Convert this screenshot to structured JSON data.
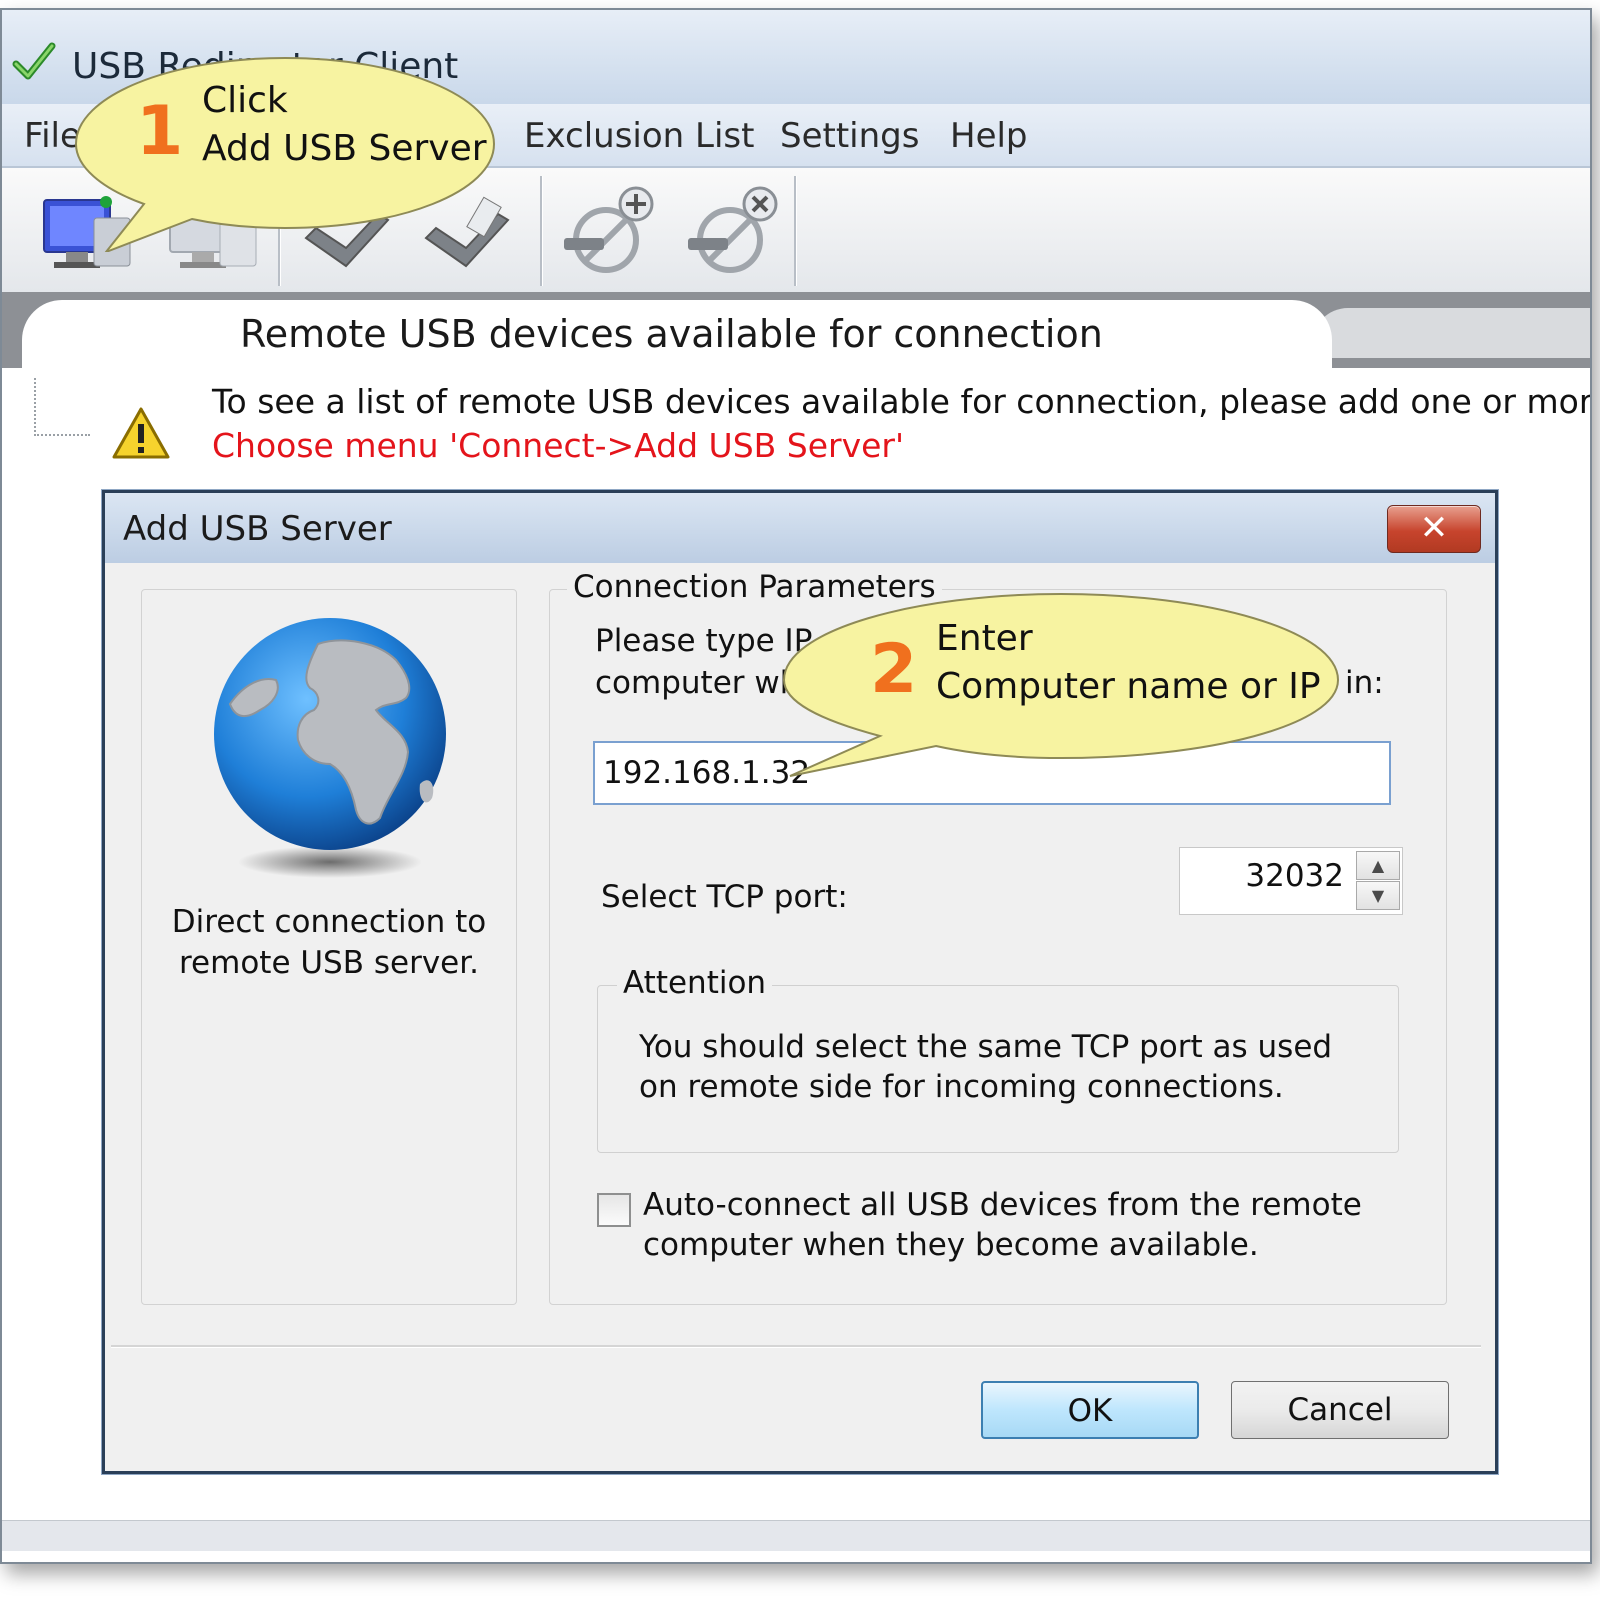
{
  "window": {
    "title": "USB Redirector Client"
  },
  "menu": [
    "File",
    "Exclusion List",
    "Settings",
    "Help"
  ],
  "toolbar": {
    "buttons": [
      "add-usb-server",
      "remove-usb-server",
      "connect-device",
      "disconnect-device",
      "add-exclusion",
      "remove-exclusion"
    ]
  },
  "tab": {
    "title": "Remote USB devices available for connection"
  },
  "info": {
    "line1": "To see a list of remote USB devices available for connection, please add one or more",
    "line2": "Choose menu 'Connect->Add USB Server'"
  },
  "callout1": {
    "number": "1",
    "line1": "Click",
    "line2": "Add USB Server"
  },
  "callout2": {
    "number": "2",
    "line1": "Enter",
    "line2": "Computer name or IP"
  },
  "dialog": {
    "title": "Add USB Server",
    "close_label": "✕",
    "left_caption": "Direct connection to remote USB server.",
    "group_title": "Connection Parameters",
    "prompt_line1": "Please type IP",
    "prompt_line2": "computer whe",
    "prompt_tail": "in:",
    "ip_value": "192.168.1.32",
    "port_label": "Select TCP port:",
    "port_value": "32032",
    "attention_title": "Attention",
    "attention_text": "You should select the same TCP port as used on remote side for incoming connections.",
    "autoconnect_label": "Auto-connect all USB devices from the remote computer when they become available.",
    "autoconnect_checked": false,
    "ok_label": "OK",
    "cancel_label": "Cancel"
  },
  "colors": {
    "callout_fill": "#f7f3a1",
    "callout_number": "#f0701e",
    "warning_text": "#e4141b",
    "globe_blue": "#1f7fd8"
  }
}
